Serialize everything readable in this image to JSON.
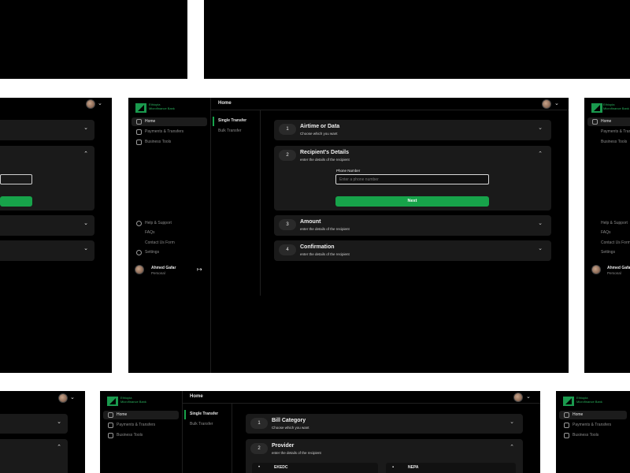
{
  "colors": {
    "background": "#000000",
    "accent": "#17a34a",
    "card": "#1a1a1a"
  },
  "logo": {
    "text": "Ethiopia Microfinance Bank"
  },
  "header": {
    "title": "Home"
  },
  "sidebar": {
    "items": [
      {
        "label": "Home",
        "icon": "home-icon"
      },
      {
        "label": "Payments & Transfers",
        "icon": "payments-icon"
      },
      {
        "label": "Business Tools",
        "icon": "briefcase-icon"
      }
    ],
    "help": [
      {
        "label": "Help & Support",
        "icon": "headset-icon"
      },
      {
        "label": "FAQs",
        "icon": ""
      },
      {
        "label": "Contact Us Form",
        "icon": ""
      },
      {
        "label": "Settings",
        "icon": "gear-icon"
      }
    ],
    "user": {
      "name": "Ahmed Gafar",
      "role": "Personal"
    }
  },
  "subnav": {
    "items": [
      "Single Transfer",
      "Bulk Transfer"
    ]
  },
  "steps": [
    {
      "num": "1",
      "title": "Airtime or Data",
      "sub": "Choose which you want"
    },
    {
      "num": "2",
      "title": "Recipient's Details",
      "sub": "enter the details of the recipient"
    },
    {
      "num": "3",
      "title": "Amount",
      "sub": "enter the details of the recipient"
    },
    {
      "num": "4",
      "title": "Confirmation",
      "sub": "enter the details of the recipient"
    }
  ],
  "form": {
    "phone_label": "Phone Number",
    "phone_placeholder": "Enter a phone number",
    "next": "Next"
  },
  "bills": {
    "steps": [
      {
        "num": "1",
        "title": "Bill Category",
        "sub": "Choose which you want"
      },
      {
        "num": "2",
        "title": "Provider",
        "sub": "enter the details of the recipient"
      }
    ],
    "providers": [
      "EKEDC",
      "NEPA"
    ]
  }
}
